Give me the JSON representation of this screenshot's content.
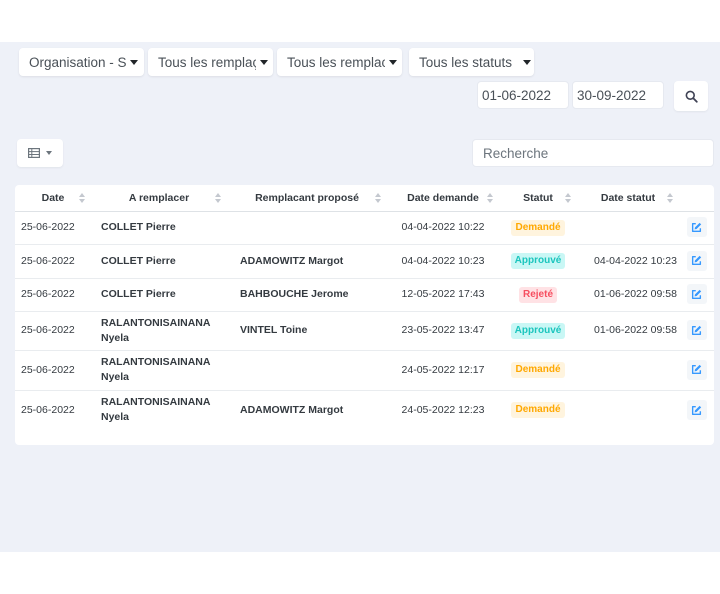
{
  "filters": {
    "organisation": "Organisation - SI",
    "remplaces": "Tous les remplaç",
    "remplacants": "Tous les remplac",
    "statuts": "Tous les statuts"
  },
  "dates": {
    "start": "01-06-2022",
    "end": "30-09-2022"
  },
  "icons": {
    "search": "search-icon",
    "table_view": "table-list-icon",
    "edit": "edit-icon"
  },
  "search": {
    "placeholder": "Recherche"
  },
  "colors": {
    "background": "#eef1f8",
    "edit_icon": "#3699ff",
    "demande": "#ffa800",
    "approuve": "#1bc5bd",
    "rejete": "#f64e60"
  },
  "table": {
    "headers": [
      "Date",
      "A remplacer",
      "Remplacant proposé",
      "Date demande",
      "Statut",
      "Date statut"
    ],
    "rows": [
      {
        "date": "25-06-2022",
        "remplace": "COLLET Pierre",
        "remplacant": "",
        "date_demande": "04-04-2022 10:22",
        "statut": "Demandé",
        "statut_class": "demande",
        "date_statut": ""
      },
      {
        "date": "25-06-2022",
        "remplace": "COLLET Pierre",
        "remplacant": "ADAMOWITZ Margot",
        "date_demande": "04-04-2022 10:23",
        "statut": "Approuvé",
        "statut_class": "approuve",
        "date_statut": "04-04-2022 10:23"
      },
      {
        "date": "25-06-2022",
        "remplace": "COLLET Pierre",
        "remplacant": "BAHBOUCHE Jerome",
        "date_demande": "12-05-2022 17:43",
        "statut": "Rejeté",
        "statut_class": "rejete",
        "date_statut": "01-06-2022 09:58"
      },
      {
        "date": "25-06-2022",
        "remplace": "RALANTONISAINANA Nyela",
        "remplacant": "VINTEL Toine",
        "date_demande": "23-05-2022 13:47",
        "statut": "Approuvé",
        "statut_class": "approuve",
        "date_statut": "01-06-2022 09:58"
      },
      {
        "date": "25-06-2022",
        "remplace": "RALANTONISAINANA Nyela",
        "remplacant": "",
        "date_demande": "24-05-2022 12:17",
        "statut": "Demandé",
        "statut_class": "demande",
        "date_statut": ""
      },
      {
        "date": "25-06-2022",
        "remplace": "RALANTONISAINANA Nyela",
        "remplacant": "ADAMOWITZ Margot",
        "date_demande": "24-05-2022 12:23",
        "statut": "Demandé",
        "statut_class": "demande",
        "date_statut": ""
      }
    ]
  }
}
